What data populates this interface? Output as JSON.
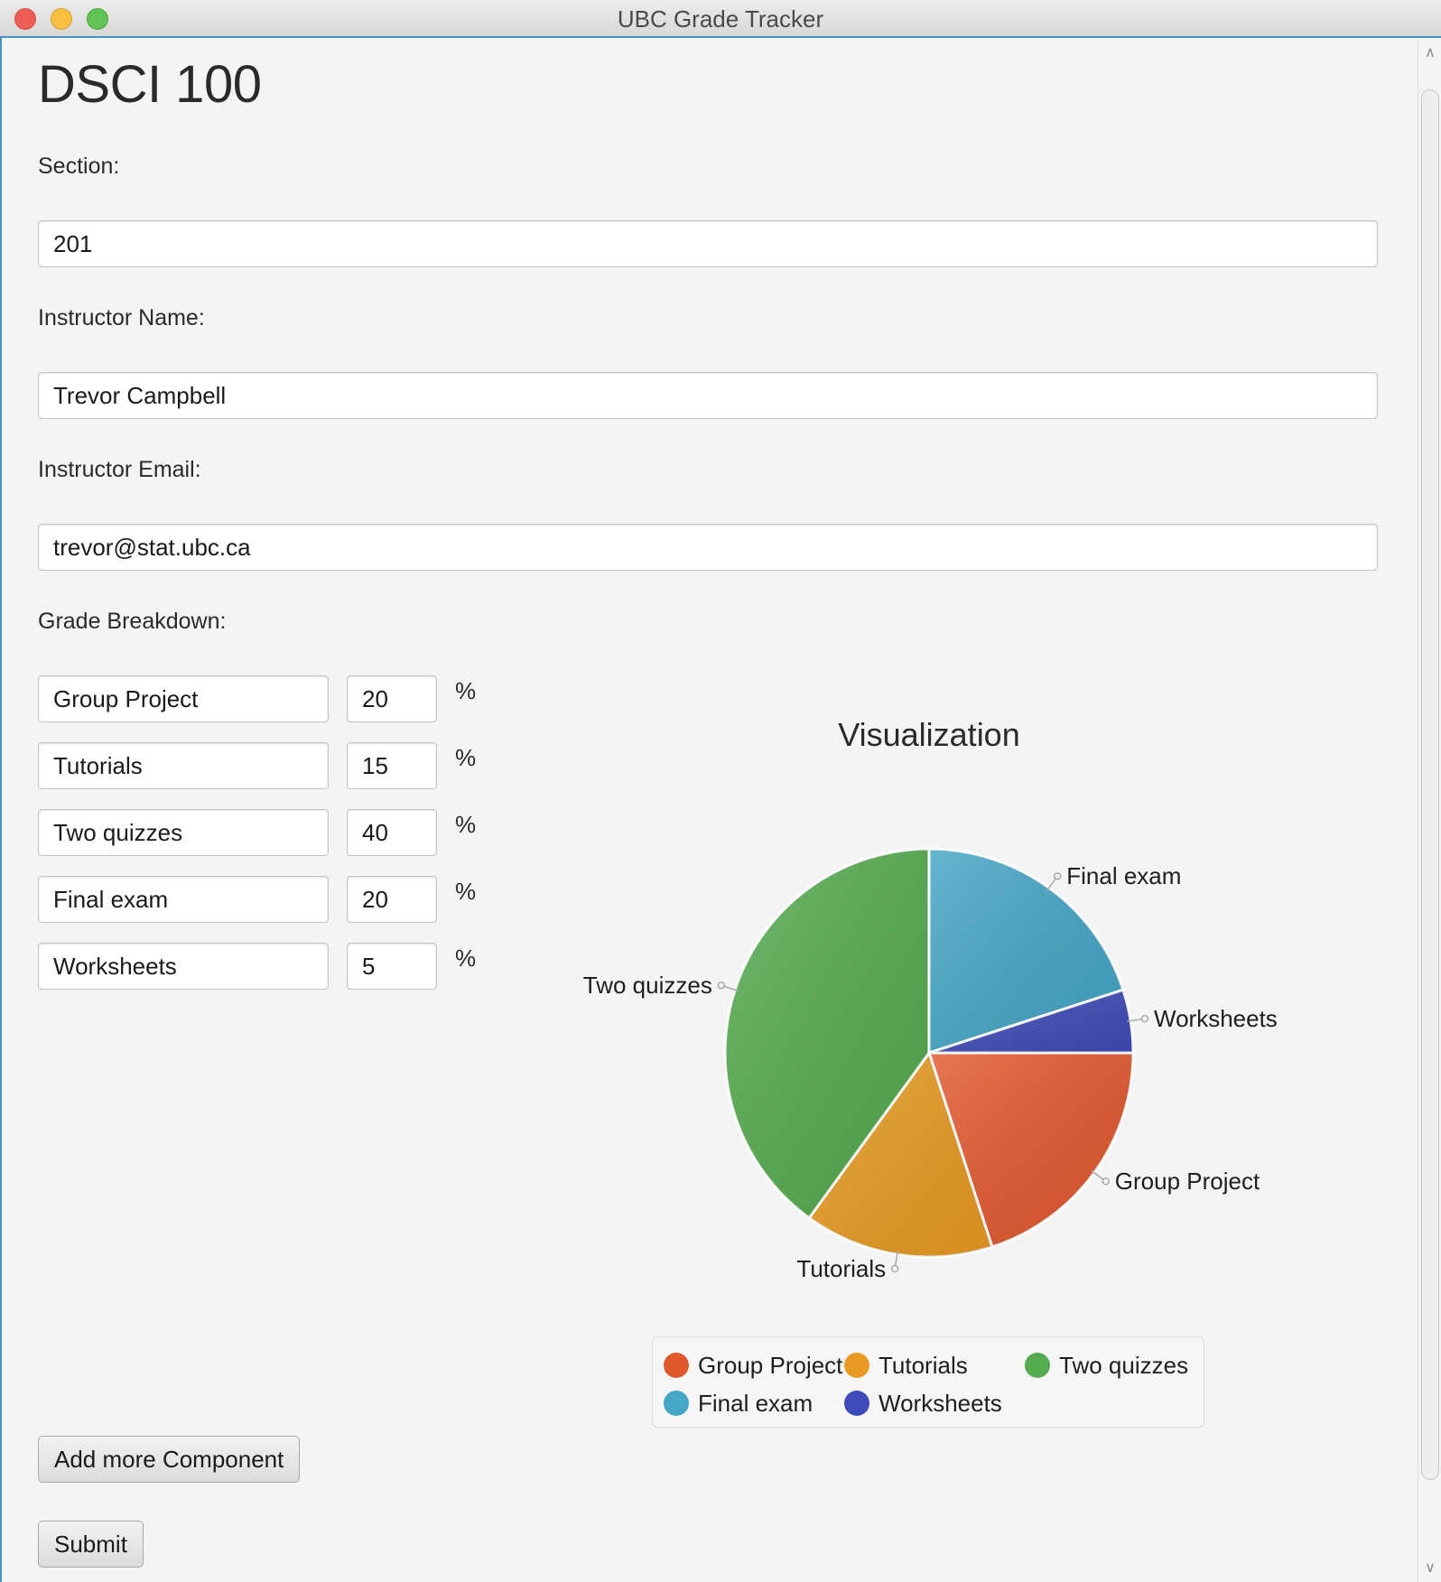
{
  "window": {
    "title": "UBC Grade Tracker"
  },
  "course": {
    "title": "DSCI 100",
    "section_label": "Section:",
    "section_value": "201",
    "instructor_name_label": "Instructor Name:",
    "instructor_name_value": "Trevor Campbell",
    "instructor_email_label": "Instructor Email:",
    "instructor_email_value": "trevor@stat.ubc.ca",
    "grade_breakdown_label": "Grade Breakdown:"
  },
  "components": [
    {
      "name": "Group Project",
      "percent": "20",
      "unit": "%"
    },
    {
      "name": "Tutorials",
      "percent": "15",
      "unit": "%"
    },
    {
      "name": "Two quizzes",
      "percent": "40",
      "unit": "%"
    },
    {
      "name": "Final exam",
      "percent": "20",
      "unit": "%"
    },
    {
      "name": "Worksheets",
      "percent": "5",
      "unit": "%"
    }
  ],
  "buttons": {
    "add_component": "Add more Component",
    "submit": "Submit"
  },
  "chart_data": {
    "type": "pie",
    "title": "Visualization",
    "start_angle_deg": 0,
    "direction": "clockwise-from-east",
    "legend_position": "bottom",
    "slices": [
      {
        "label": "Group Project",
        "value": 20,
        "color": "#e2582e"
      },
      {
        "label": "Tutorials",
        "value": 15,
        "color": "#e89b22"
      },
      {
        "label": "Two quizzes",
        "value": 40,
        "color": "#55ab4f"
      },
      {
        "label": "Final exam",
        "value": 20,
        "color": "#45a6c6"
      },
      {
        "label": "Worksheets",
        "value": 5,
        "color": "#3f4bb8"
      }
    ]
  }
}
